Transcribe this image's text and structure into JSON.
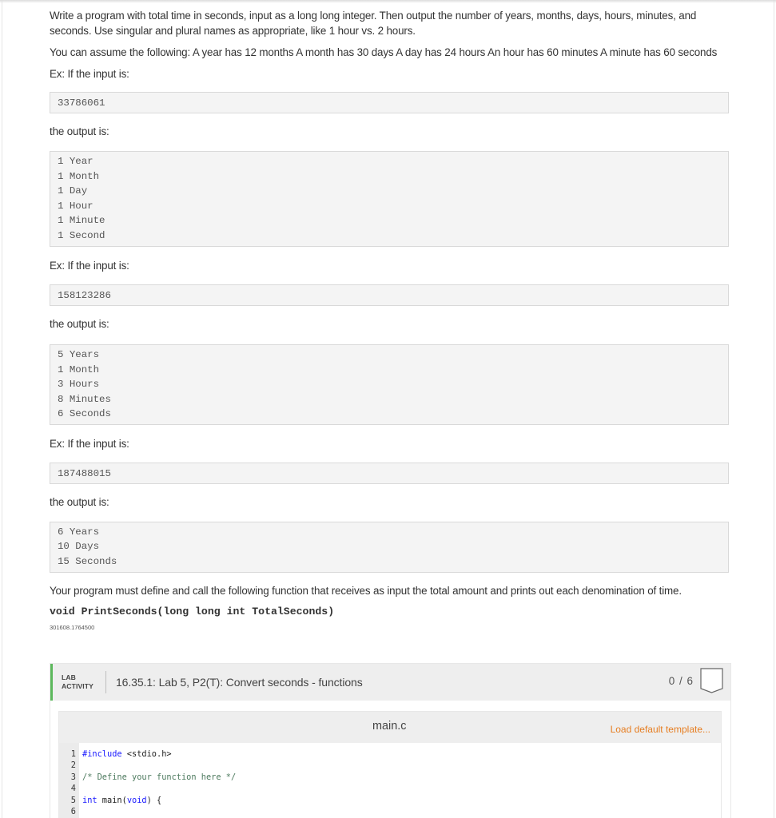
{
  "problem": {
    "intro": "Write a program with total time in seconds, input as a long long integer. Then output the number of years, months, days, hours, minutes, and seconds. Use singular and plural names as appropriate, like 1 hour vs. 2 hours.",
    "assumptions": "You can assume the following: A year has 12 months A month has 30 days A day has 24 hours An hour has 60 minutes A minute has 60 seconds",
    "examples": [
      {
        "input_label": "Ex: If the input is:",
        "input": "33786061",
        "output_label": "the output is:",
        "output_lines": [
          "1 Year",
          "1 Month",
          "1 Day",
          "1 Hour",
          "1 Minute",
          "1 Second"
        ]
      },
      {
        "input_label": "Ex: If the input is:",
        "input": "158123286",
        "output_label": "the output is:",
        "output_lines": [
          "5 Years",
          "1 Month",
          "3 Hours",
          "8 Minutes",
          "6 Seconds"
        ]
      },
      {
        "input_label": "Ex: If the input is:",
        "input": "187488015",
        "output_label": "the output is:",
        "output_lines": [
          "6 Years",
          "10 Days",
          "15 Seconds"
        ]
      }
    ],
    "function_requirement": "Your program must define and call the following function that receives as input the total amount and prints out each denomination of time.",
    "function_signature": "void PrintSeconds(long long int TotalSeconds)",
    "problem_id": "301608.1764500"
  },
  "lab": {
    "tag_line1": "LAB",
    "tag_line2": "ACTIVITY",
    "title": "16.35.1: Lab 5, P2(T): Convert seconds - functions",
    "score": "0 / 6",
    "accent_color": "#5cb85c",
    "badge_icon": "completion-badge-icon"
  },
  "editor": {
    "filename": "main.c",
    "load_template_label": "Load default template...",
    "link_color": "#e67e22",
    "line_numbers": [
      "1",
      "2",
      "3",
      "4",
      "5",
      "6"
    ],
    "lines": [
      [
        {
          "t": "#include",
          "c": "kw"
        },
        {
          "t": " <stdio.h>",
          "c": ""
        }
      ],
      [],
      [
        {
          "t": "/* Define your function here */",
          "c": "cm"
        }
      ],
      [],
      [
        {
          "t": "int",
          "c": "kw"
        },
        {
          "t": " main(",
          "c": ""
        },
        {
          "t": "void",
          "c": "kw"
        },
        {
          "t": ") {",
          "c": ""
        }
      ],
      []
    ]
  }
}
